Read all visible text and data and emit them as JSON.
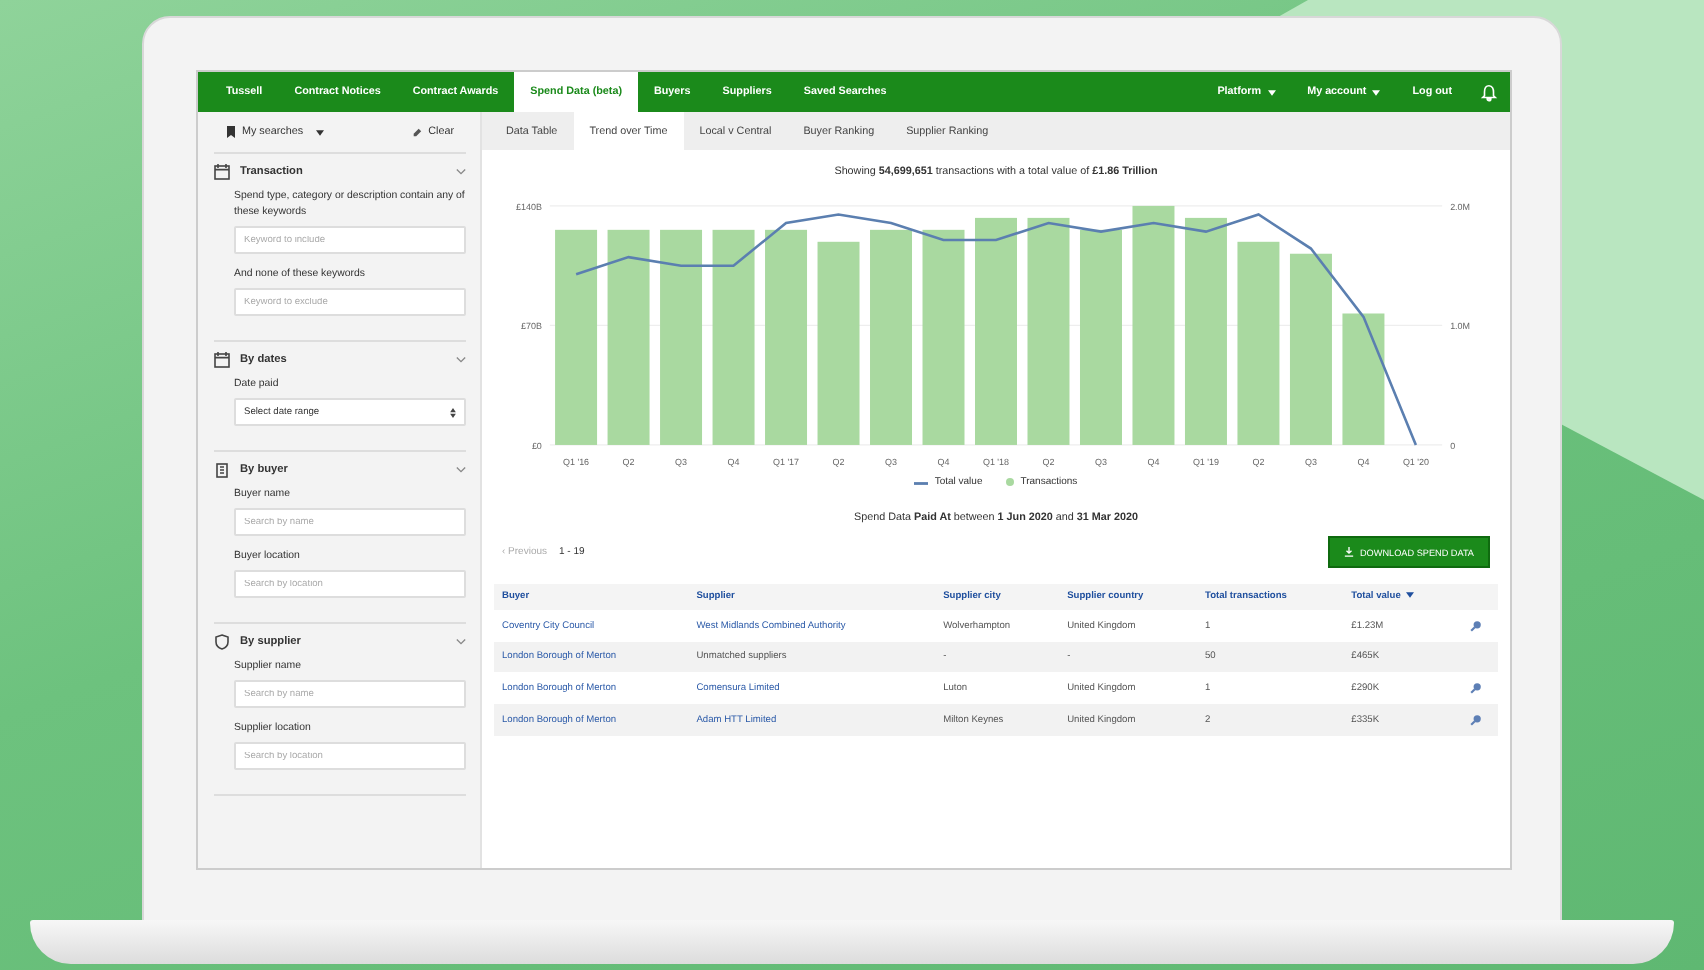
{
  "nav": {
    "items": [
      {
        "label": "Tussell",
        "selected": false
      },
      {
        "label": "Contract Notices",
        "selected": false
      },
      {
        "label": "Contract Awards",
        "selected": false
      },
      {
        "label": "Spend Data (beta)",
        "selected": true
      },
      {
        "label": "Buyers",
        "selected": false
      },
      {
        "label": "Suppliers",
        "selected": false
      },
      {
        "label": "Saved Searches",
        "selected": false
      }
    ],
    "right": [
      {
        "label": "Platform",
        "dropdown": true
      },
      {
        "label": "My account",
        "dropdown": true
      },
      {
        "label": "Log out",
        "dropdown": false
      }
    ]
  },
  "sidebar": {
    "my_searches": "My searches",
    "clear": "Clear",
    "sections": [
      {
        "title": "Transaction",
        "expanded": true,
        "fields": [
          {
            "label": "Spend type, category or description contain any of these keywords",
            "kind": "text",
            "placeholder": "Keyword to include"
          },
          {
            "label": "And none of these keywords",
            "kind": "text",
            "placeholder": "Keyword to exclude"
          }
        ]
      },
      {
        "title": "By dates",
        "expanded": true,
        "fields": [
          {
            "label": "Date paid",
            "kind": "select",
            "value": "Select date range"
          }
        ]
      },
      {
        "title": "By buyer",
        "expanded": true,
        "fields": [
          {
            "label": "Buyer name",
            "kind": "text",
            "placeholder": "Search by name"
          },
          {
            "label": "Buyer location",
            "kind": "text",
            "placeholder": "Search by location"
          }
        ]
      },
      {
        "title": "By supplier",
        "expanded": true,
        "fields": [
          {
            "label": "Supplier name",
            "kind": "text",
            "placeholder": "Search by name"
          },
          {
            "label": "Supplier location",
            "kind": "text",
            "placeholder": "Search by location"
          }
        ]
      }
    ]
  },
  "tabs": [
    {
      "label": "Data Table",
      "selected": false
    },
    {
      "label": "Trend over Time",
      "selected": true
    },
    {
      "label": "Local v Central",
      "selected": false
    },
    {
      "label": "Buyer Ranking",
      "selected": false
    },
    {
      "label": "Supplier Ranking",
      "selected": false
    }
  ],
  "summary": "Showing **54,699,651** transactions with a total value of **£1.86 Trillion**",
  "chart_data": {
    "type": "bar",
    "categories": [
      "Q1 '16",
      "Q2",
      "Q3",
      "Q4",
      "Q1 '17",
      "Q2",
      "Q3",
      "Q4",
      "Q1 '18",
      "Q2",
      "Q3",
      "Q4",
      "Q1 '19",
      "Q2",
      "Q3",
      "Q4",
      "Q1 '20"
    ],
    "series": [
      {
        "name": "Total value",
        "type": "line",
        "axis": "y2",
        "color": "#5b7fb0",
        "values": [
          100,
          110,
          105,
          105,
          130,
          135,
          130,
          120,
          120,
          130,
          125,
          130,
          125,
          135,
          115,
          75,
          0
        ]
      },
      {
        "name": "Transactions",
        "type": "bar",
        "color": "#a9d9a0",
        "values": [
          1.8,
          1.8,
          1.8,
          1.8,
          1.8,
          1.7,
          1.8,
          1.8,
          1.9,
          1.9,
          1.8,
          2,
          1.9,
          1.7,
          1.6,
          1.1,
          null
        ]
      }
    ],
    "ylim": [
      0,
      2
    ],
    "yticks": [
      {
        "value": 0,
        "label": "0"
      },
      {
        "value": 1,
        "label": "1.0M"
      },
      {
        "value": 2,
        "label": "2.0M"
      }
    ],
    "legend": "bottom",
    "y2lim": [
      0,
      140
    ],
    "y2ticks": [
      {
        "value": 0,
        "label": "£0"
      },
      {
        "value": 70,
        "label": "£70B"
      },
      {
        "value": 140,
        "label": "£140B"
      }
    ]
  },
  "caption": "Spend Data **Paid At** between **1 Jun 2020** and **31 Mar 2020**",
  "pagination": {
    "previous": "‹ Previous",
    "range": "1 - 19"
  },
  "download_button": "DOWNLOAD SPEND DATA",
  "table": {
    "columns": [
      {
        "label": "Buyer",
        "sorted": false
      },
      {
        "label": "Supplier",
        "sorted": false
      },
      {
        "label": "Supplier city",
        "sorted": false
      },
      {
        "label": "Supplier country",
        "sorted": false
      },
      {
        "label": "Total transactions",
        "sorted": false
      },
      {
        "label": "Total value",
        "sorted": true
      }
    ],
    "rows": [
      {
        "cells": [
          "Coventry City Council",
          "West Midlands Combined Authority",
          "Wolverhampton",
          "United Kingdom",
          "1",
          "£1.23M"
        ],
        "supplier_link": true,
        "action": true
      },
      {
        "cells": [
          "London Borough of Merton",
          "Unmatched suppliers",
          "-",
          "-",
          "50",
          "£465K"
        ],
        "supplier_link": false,
        "action": false
      },
      {
        "cells": [
          "London Borough of Merton",
          "Comensura Limited",
          "Luton",
          "United Kingdom",
          "1",
          "£290K"
        ],
        "supplier_link": true,
        "action": true
      },
      {
        "cells": [
          "London Borough of Merton",
          "Adam HTT Limited",
          "Milton Keynes",
          "United Kingdom",
          "2",
          "£335K"
        ],
        "supplier_link": true,
        "action": true
      }
    ]
  }
}
